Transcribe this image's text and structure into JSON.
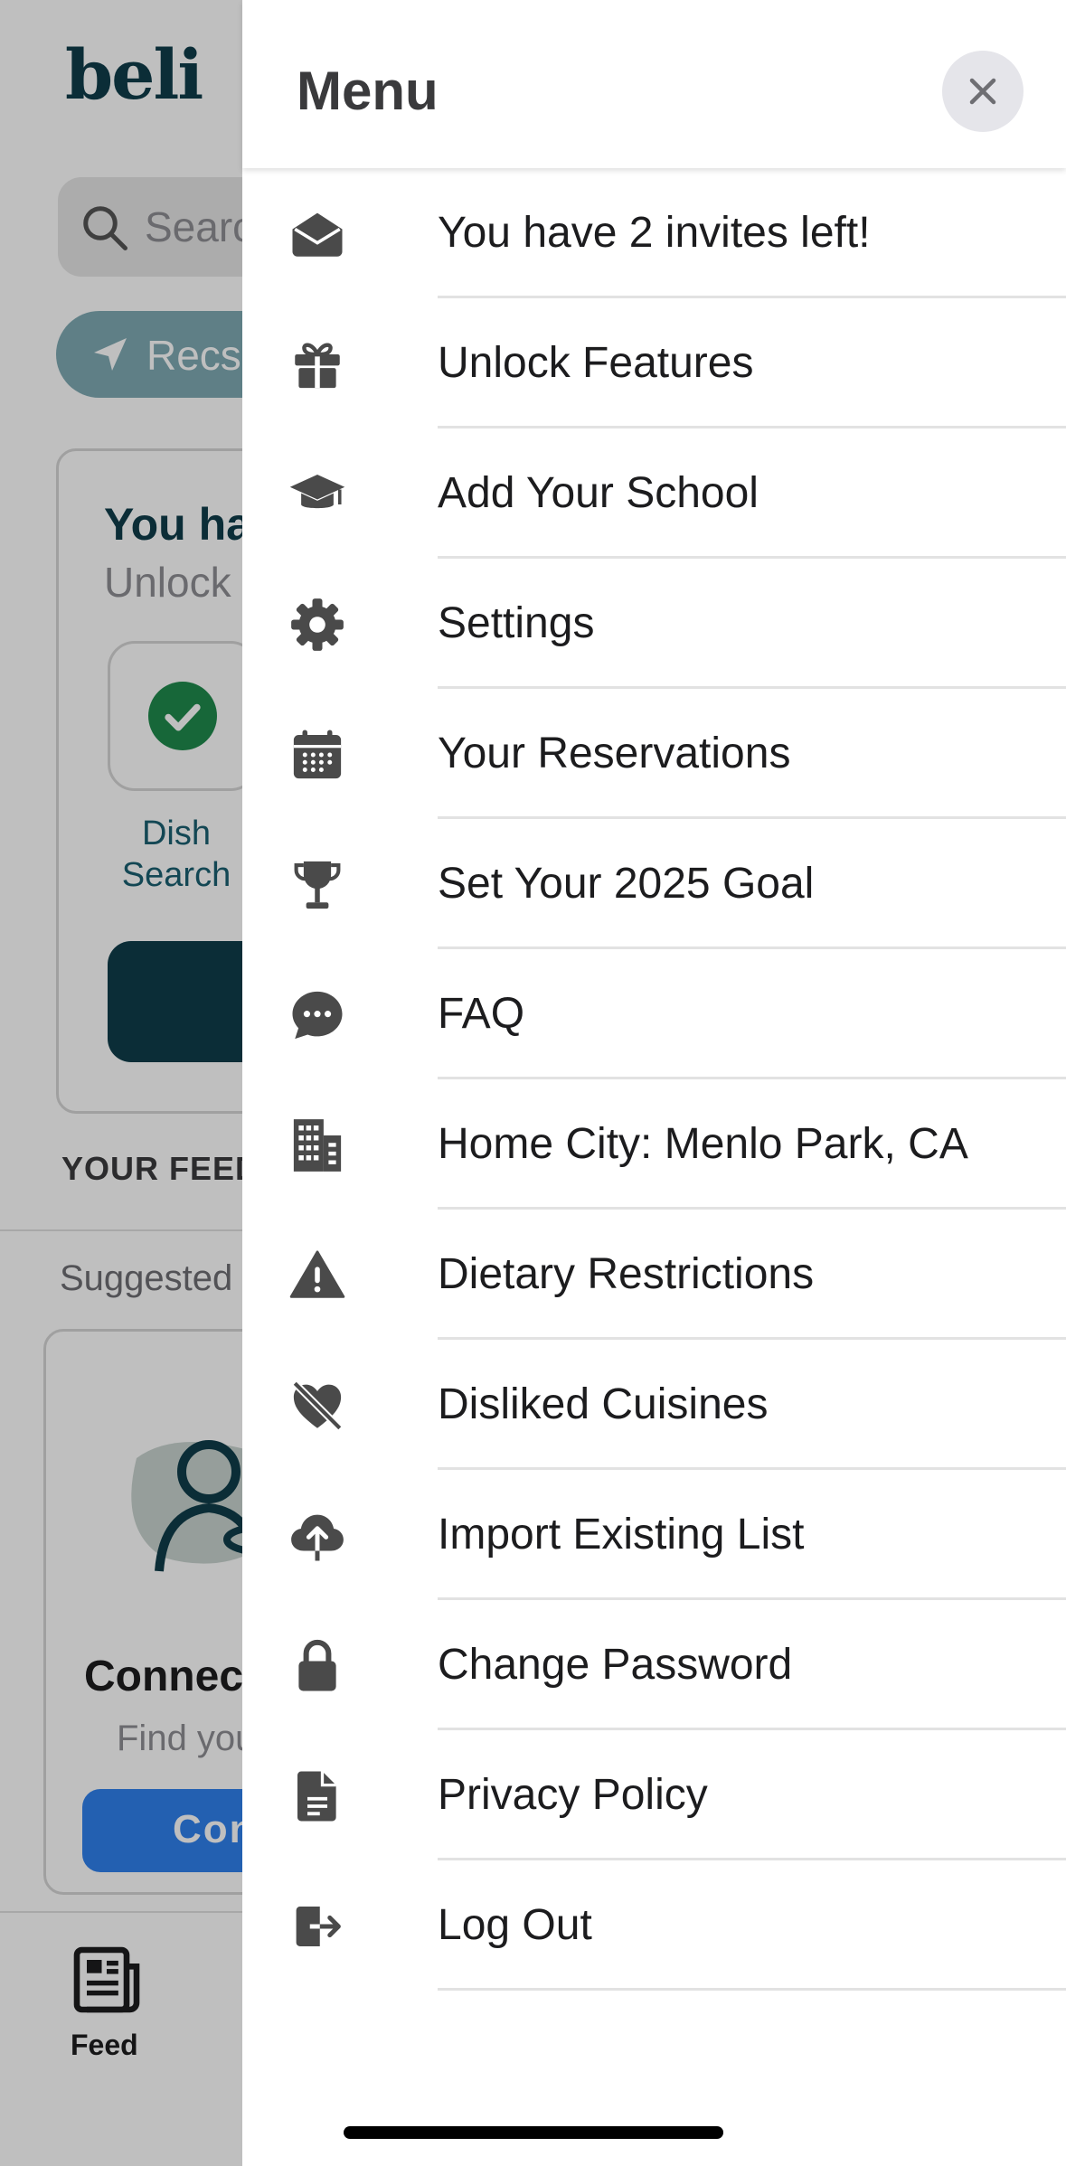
{
  "background": {
    "logo": "beli",
    "search_placeholder": "Search",
    "recs_label": "Recs",
    "invite_card": {
      "title": "You have",
      "subtitle": "Unlock",
      "feature_label": "Dish Search"
    },
    "feed_section_label": "YOUR FEED",
    "suggested_label": "Suggested",
    "connect_card": {
      "title": "Connect",
      "subtitle": "Find your",
      "button_label": "Connect"
    },
    "tab_bar": {
      "feed_label": "Feed"
    }
  },
  "drawer": {
    "title": "Menu",
    "close_icon": "close-icon",
    "items": [
      {
        "label": "You have 2 invites left!",
        "icon": "envelope-open-icon"
      },
      {
        "label": "Unlock Features",
        "icon": "gift-icon"
      },
      {
        "label": "Add Your School",
        "icon": "graduation-cap-icon"
      },
      {
        "label": "Settings",
        "icon": "gear-icon"
      },
      {
        "label": "Your Reservations",
        "icon": "calendar-icon"
      },
      {
        "label": "Set Your 2025 Goal",
        "icon": "trophy-icon"
      },
      {
        "label": "FAQ",
        "icon": "chat-bubble-icon"
      },
      {
        "label": "Home City: Menlo Park, CA",
        "icon": "building-icon"
      },
      {
        "label": "Dietary Restrictions",
        "icon": "warning-icon"
      },
      {
        "label": "Disliked Cuisines",
        "icon": "heart-slash-icon"
      },
      {
        "label": "Import Existing List",
        "icon": "cloud-upload-icon"
      },
      {
        "label": "Change Password",
        "icon": "lock-icon"
      },
      {
        "label": "Privacy Policy",
        "icon": "document-icon"
      },
      {
        "label": "Log Out",
        "icon": "logout-icon"
      }
    ]
  },
  "colors": {
    "brand_teal": "#0f3d4a",
    "accent_blue": "#2f80ed",
    "icon_gray": "#4a4a4a",
    "divider": "#e2e2e2",
    "dim_overlay": "rgba(0,0,0,0.25)"
  }
}
